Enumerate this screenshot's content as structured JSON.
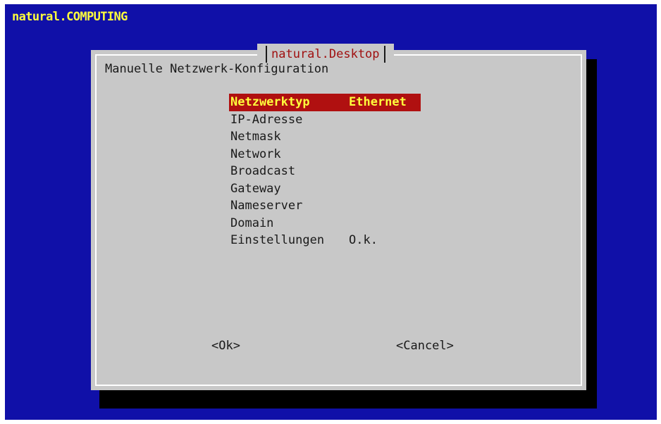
{
  "console": {
    "title": "natural.COMPUTING"
  },
  "dialog": {
    "title": "natural.Desktop",
    "subtitle": "Manuelle Netzwerk-Konfiguration",
    "menu": [
      {
        "label": "Netzwerktyp",
        "value": "Ethernet",
        "selected": true
      },
      {
        "label": "IP-Adresse",
        "value": ""
      },
      {
        "label": "Netmask",
        "value": ""
      },
      {
        "label": "Network",
        "value": ""
      },
      {
        "label": "Broadcast",
        "value": ""
      },
      {
        "label": "Gateway",
        "value": ""
      },
      {
        "label": "Nameserver",
        "value": ""
      },
      {
        "label": "Domain",
        "value": ""
      },
      {
        "label": "Einstellungen",
        "value": "O.k."
      }
    ],
    "buttons": {
      "ok": "<Ok>",
      "cancel": "<Cancel>"
    }
  },
  "colors": {
    "console_background": "#1010a8",
    "console_title": "#ffff3c",
    "dialog_background": "#c8c8c8",
    "dialog_title": "#a01010",
    "selection_background": "#b01010",
    "selection_text": "#ffff3c"
  }
}
